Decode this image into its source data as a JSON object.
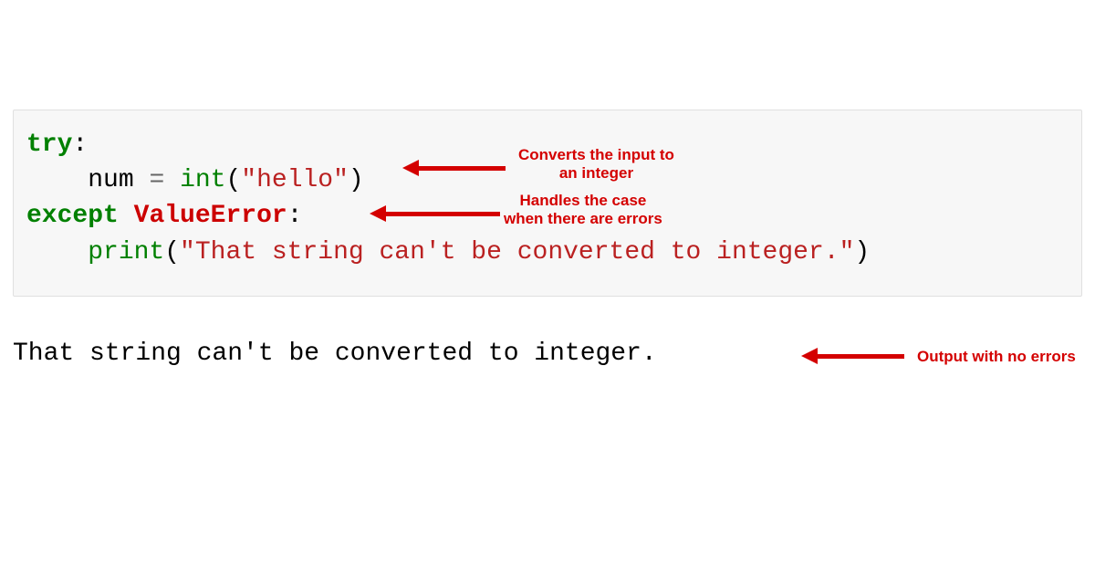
{
  "code": {
    "try_keyword": "try",
    "colon1": ":",
    "indent": "    ",
    "num_var": "num",
    "equals": " = ",
    "int_func": "int",
    "open_paren1": "(",
    "hello_string": "\"hello\"",
    "close_paren1": ")",
    "except_keyword": "except",
    "space": " ",
    "valueerror": "ValueError",
    "colon2": ":",
    "print_func": "print",
    "open_paren2": "(",
    "print_string": "\"That string can't be converted to integer.\"",
    "close_paren2": ")"
  },
  "output": "That string can't be converted to integer.",
  "annotations": {
    "convert_label_line1": "Converts the input to",
    "convert_label_line2": "an integer",
    "handles_label_line1": "Handles the case",
    "handles_label_line2": "when there are errors",
    "output_label": "Output with no errors"
  }
}
